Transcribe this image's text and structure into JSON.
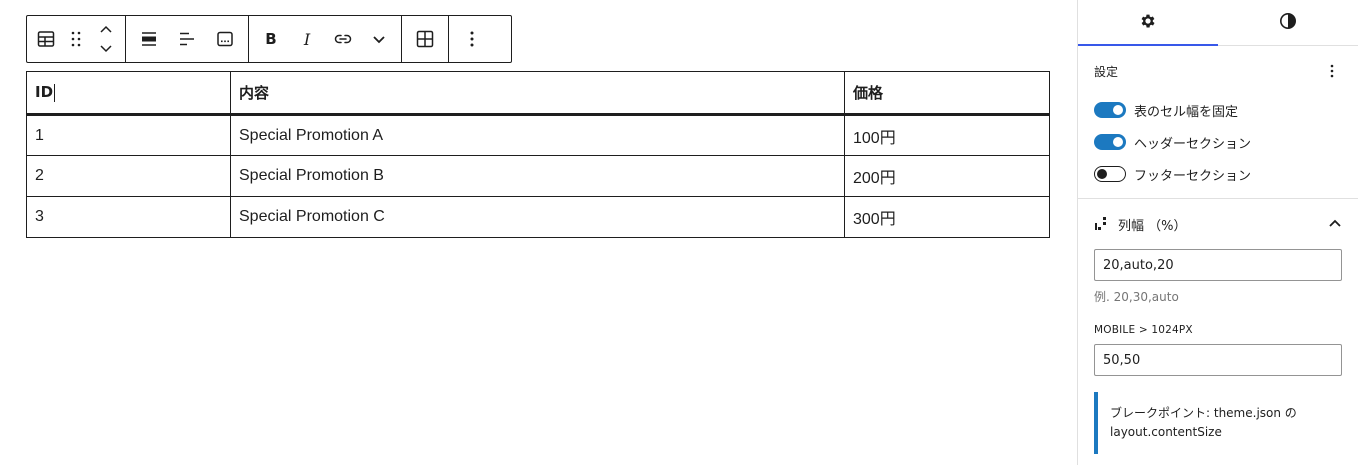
{
  "toolbar": {
    "groups": [
      {
        "icons": [
          "table-block-icon",
          "drag-handle-icon",
          "move-up-icon",
          "move-down-icon"
        ]
      },
      {
        "icons": [
          "align-wide-icon",
          "align-text-icon",
          "caption-icon"
        ]
      },
      {
        "icons": [
          "bold-icon",
          "italic-icon",
          "link-icon",
          "chevron-down-icon"
        ]
      },
      {
        "icons": [
          "edit-table-icon"
        ]
      },
      {
        "icons": [
          "options-icon"
        ]
      }
    ],
    "bold_label": "B",
    "italic_label": "I"
  },
  "table": {
    "headers": [
      "ID",
      "内容",
      "価格"
    ],
    "rows": [
      [
        "1",
        "Special Promotion A",
        "100円"
      ],
      [
        "2",
        "Special Promotion B",
        "200円"
      ],
      [
        "3",
        "Special Promotion C",
        "300円"
      ]
    ]
  },
  "sidebar": {
    "tabs": [
      {
        "icon": "gear-icon",
        "active": true
      },
      {
        "icon": "contrast-icon",
        "active": false
      }
    ],
    "settings": {
      "title": "設定",
      "toggles": [
        {
          "label": "表のセル幅を固定",
          "on": true
        },
        {
          "label": "ヘッダーセクション",
          "on": true
        },
        {
          "label": "フッターセクション",
          "on": false
        }
      ]
    },
    "column_width": {
      "title": "列幅 （%）",
      "value": "20,auto,20",
      "help": "例. 20,30,auto",
      "mobile_label": "MOBILE > 1024PX",
      "mobile_value": "50,50",
      "notice": "ブレークポイント: theme.json の layout.contentSize"
    }
  },
  "colors": {
    "accent": "#1c79c0",
    "text": "#1e1e1e",
    "border": "#e0e0e0",
    "muted": "#757575"
  }
}
